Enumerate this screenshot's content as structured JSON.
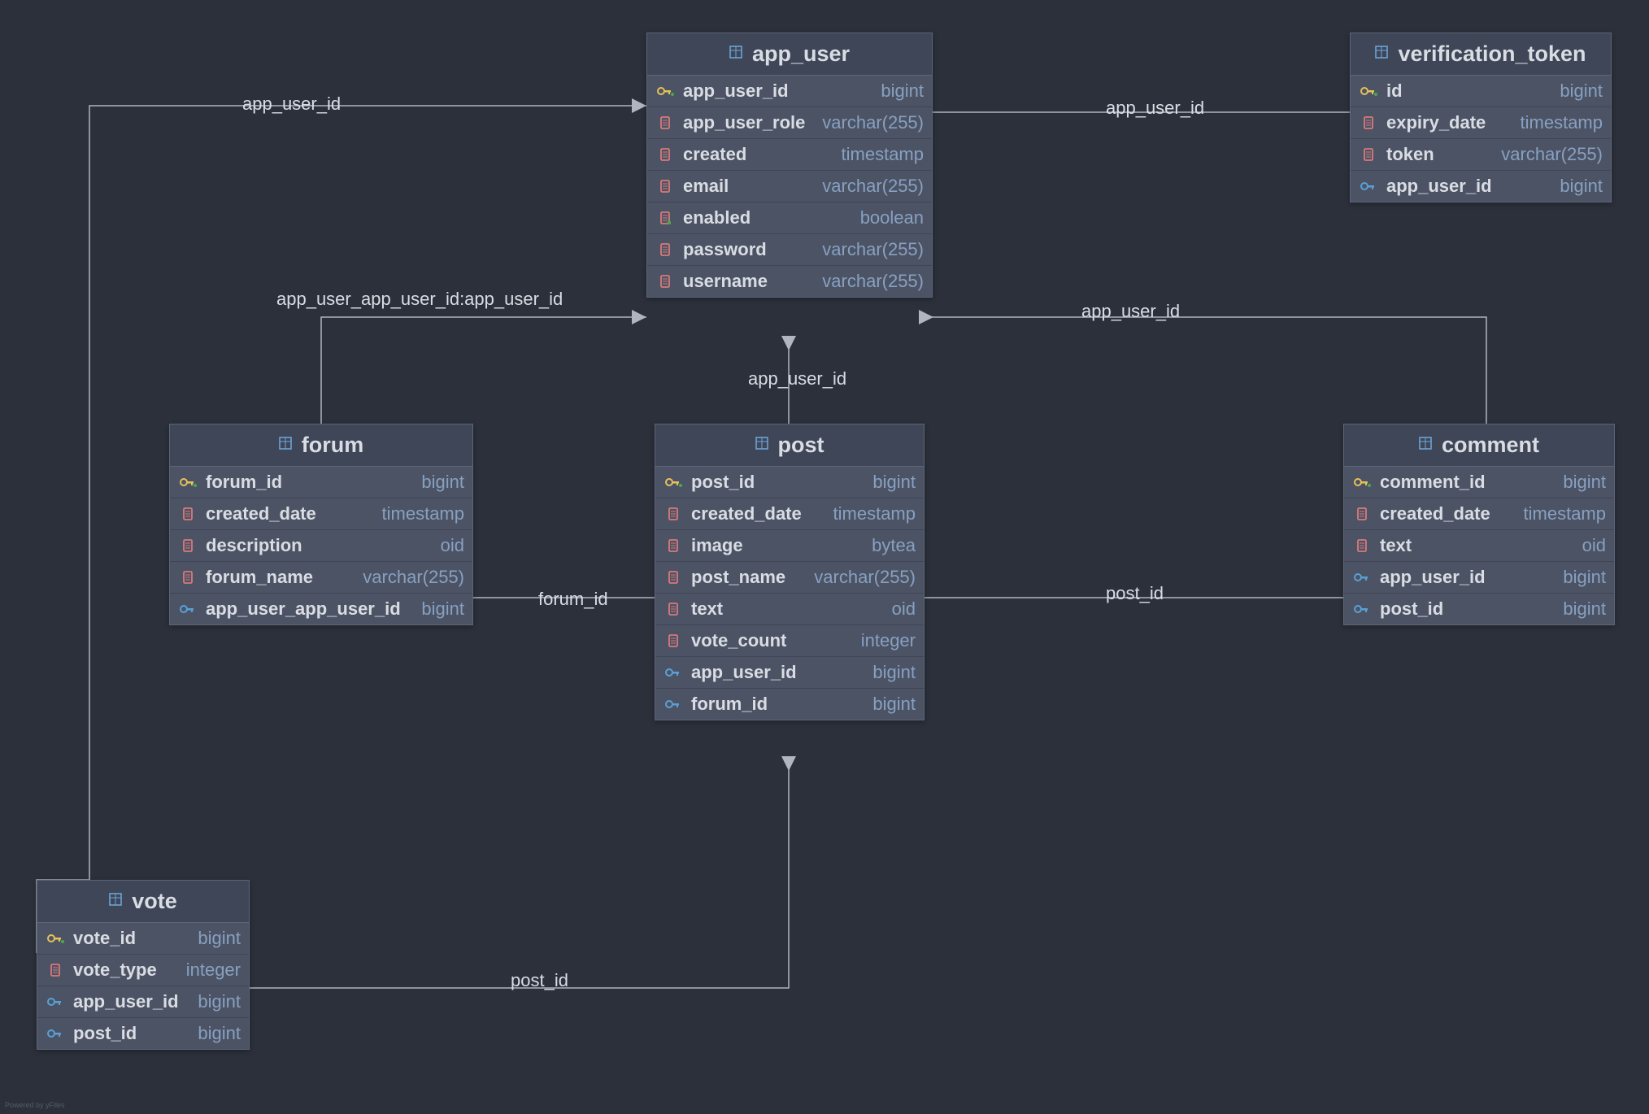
{
  "tables": {
    "app_user": {
      "title": "app_user",
      "columns": [
        {
          "name": "app_user_id",
          "type": "bigint",
          "icon": "pk"
        },
        {
          "name": "app_user_role",
          "type": "varchar(255)",
          "icon": "col"
        },
        {
          "name": "created",
          "type": "timestamp",
          "icon": "col"
        },
        {
          "name": "email",
          "type": "varchar(255)",
          "icon": "col"
        },
        {
          "name": "enabled",
          "type": "boolean",
          "icon": "coldot"
        },
        {
          "name": "password",
          "type": "varchar(255)",
          "icon": "col"
        },
        {
          "name": "username",
          "type": "varchar(255)",
          "icon": "col"
        }
      ]
    },
    "verification_token": {
      "title": "verification_token",
      "columns": [
        {
          "name": "id",
          "type": "bigint",
          "icon": "pk"
        },
        {
          "name": "expiry_date",
          "type": "timestamp",
          "icon": "col"
        },
        {
          "name": "token",
          "type": "varchar(255)",
          "icon": "col"
        },
        {
          "name": "app_user_id",
          "type": "bigint",
          "icon": "fk"
        }
      ]
    },
    "forum": {
      "title": "forum",
      "columns": [
        {
          "name": "forum_id",
          "type": "bigint",
          "icon": "pk"
        },
        {
          "name": "created_date",
          "type": "timestamp",
          "icon": "col"
        },
        {
          "name": "description",
          "type": "oid",
          "icon": "col"
        },
        {
          "name": "forum_name",
          "type": "varchar(255)",
          "icon": "col"
        },
        {
          "name": "app_user_app_user_id",
          "type": "bigint",
          "icon": "fk"
        }
      ]
    },
    "post": {
      "title": "post",
      "columns": [
        {
          "name": "post_id",
          "type": "bigint",
          "icon": "pk"
        },
        {
          "name": "created_date",
          "type": "timestamp",
          "icon": "col"
        },
        {
          "name": "image",
          "type": "bytea",
          "icon": "col"
        },
        {
          "name": "post_name",
          "type": "varchar(255)",
          "icon": "col"
        },
        {
          "name": "text",
          "type": "oid",
          "icon": "col"
        },
        {
          "name": "vote_count",
          "type": "integer",
          "icon": "col"
        },
        {
          "name": "app_user_id",
          "type": "bigint",
          "icon": "fk"
        },
        {
          "name": "forum_id",
          "type": "bigint",
          "icon": "fk"
        }
      ]
    },
    "comment": {
      "title": "comment",
      "columns": [
        {
          "name": "comment_id",
          "type": "bigint",
          "icon": "pk"
        },
        {
          "name": "created_date",
          "type": "timestamp",
          "icon": "col"
        },
        {
          "name": "text",
          "type": "oid",
          "icon": "col"
        },
        {
          "name": "app_user_id",
          "type": "bigint",
          "icon": "fk"
        },
        {
          "name": "post_id",
          "type": "bigint",
          "icon": "fk"
        }
      ]
    },
    "vote": {
      "title": "vote",
      "columns": [
        {
          "name": "vote_id",
          "type": "bigint",
          "icon": "pk"
        },
        {
          "name": "vote_type",
          "type": "integer",
          "icon": "col"
        },
        {
          "name": "app_user_id",
          "type": "bigint",
          "icon": "fk"
        },
        {
          "name": "post_id",
          "type": "bigint",
          "icon": "fk"
        }
      ]
    }
  },
  "edge_labels": {
    "vote_app_user": "app_user_id",
    "forum_app_user": "app_user_app_user_id:app_user_id",
    "post_app_user": "app_user_id",
    "verification_app_user": "app_user_id",
    "comment_app_user": "app_user_id",
    "comment_post": "post_id",
    "post_forum": "forum_id",
    "vote_post": "post_id"
  },
  "footer": "Powered by yFiles"
}
